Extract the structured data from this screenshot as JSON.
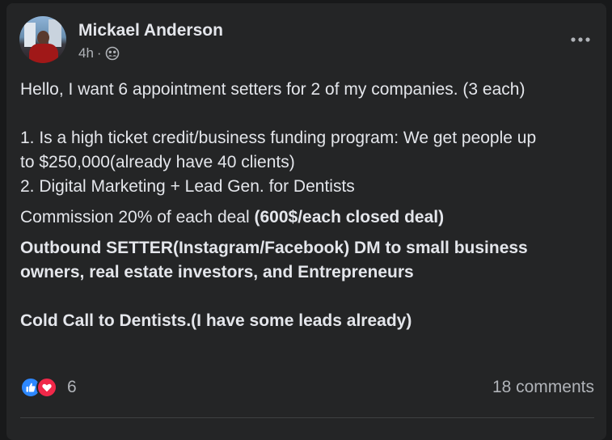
{
  "post": {
    "author": "Mickael Anderson",
    "time": "4h",
    "separator": "·",
    "audience_icon": "friends-icon",
    "lines": {
      "intro": "Hello, I want 6 appointment setters for 2 of my companies. (3 each)",
      "item1_a": "1. Is a high ticket credit/business funding program: We get people up",
      "item1_b": "to $250,000(already have 40 clients)",
      "item2": "2. Digital Marketing + Lead Gen. for Dentists",
      "commission_prefix": "Commission 20% of each deal ",
      "commission_bold": "(600$/each closed deal)",
      "outbound": "Outbound SETTER(Instagram/Facebook) DM to small business owners, real estate investors, and Entrepreneurs",
      "cold_call": "Cold Call to Dentists.(I have some leads already)"
    }
  },
  "footer": {
    "reaction_count": "6",
    "comments": "18 comments"
  },
  "colors": {
    "card_bg": "#242526",
    "page_bg": "#18191a",
    "text_primary": "#e4e6eb",
    "text_secondary": "#b0b3b8",
    "like_blue": "#2d88ff",
    "love_red": "#f02849"
  }
}
